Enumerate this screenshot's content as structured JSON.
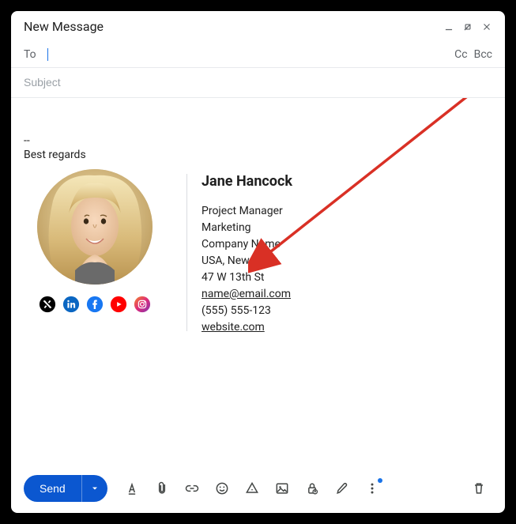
{
  "header": {
    "title": "New Message"
  },
  "recipients": {
    "to_label": "To",
    "cc_label": "Cc",
    "bcc_label": "Bcc"
  },
  "subject": {
    "placeholder": "Subject",
    "value": ""
  },
  "body": {
    "separator": "--",
    "closing": "Best regards"
  },
  "signature": {
    "name": "Jane Hancock",
    "title": "Project Manager",
    "department": "Marketing",
    "company": "Company Name",
    "location": "USA, New York",
    "address": "47 W 13th St",
    "email": "name@email.com",
    "phone": "(555) 555-123",
    "website": "website.com",
    "social": {
      "x": {
        "name": "x-icon",
        "bg": "#000000"
      },
      "linkedin": {
        "name": "linkedin-icon",
        "bg": "#0A66C2"
      },
      "facebook": {
        "name": "facebook-icon",
        "bg": "#1877F2"
      },
      "youtube": {
        "name": "youtube-icon",
        "bg": "#FF0000"
      },
      "instagram": {
        "name": "instagram-icon",
        "bg": "#E1306C"
      }
    }
  },
  "toolbar": {
    "send_label": "Send"
  },
  "annotation": {
    "arrow_color": "#d93025"
  }
}
